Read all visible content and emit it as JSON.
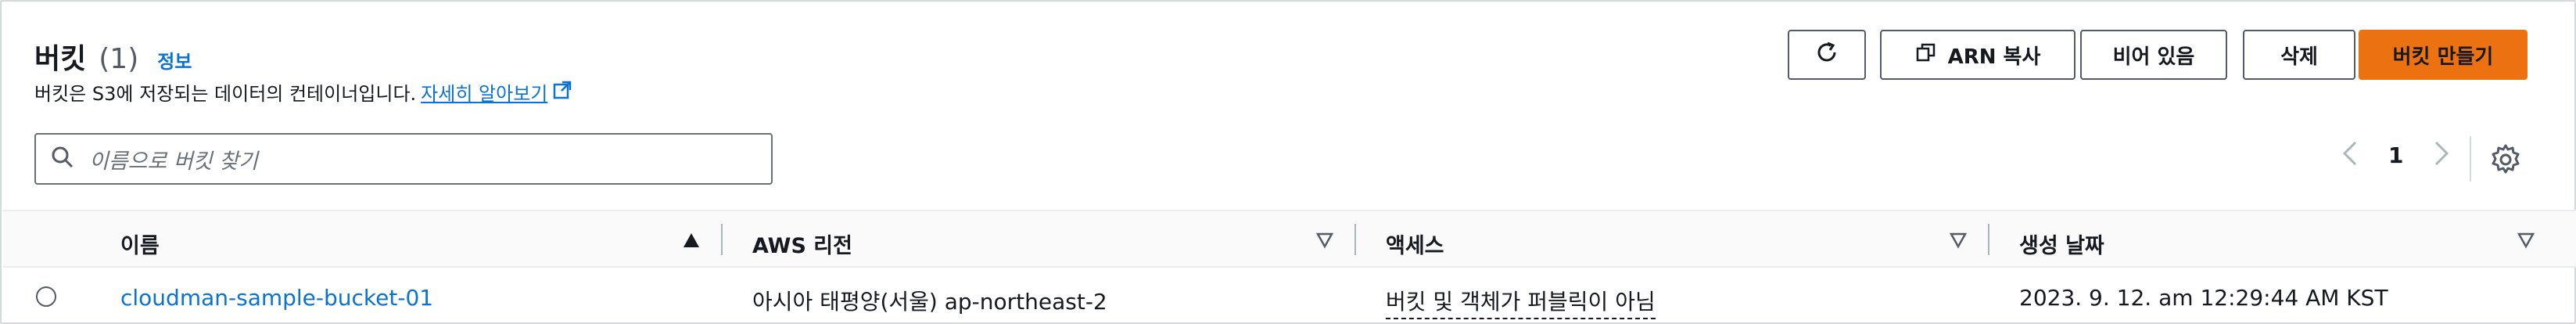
{
  "header": {
    "title": "버킷",
    "count": "(1)",
    "info": "정보",
    "description": "버킷은 S3에 저장되는 데이터의 컨테이너입니다.",
    "learn_more": "자세히 알아보기"
  },
  "toolbar": {
    "refresh_icon": "refresh-icon",
    "copy_arn": "ARN 복사",
    "empty": "비어 있음",
    "delete": "삭제",
    "create": "버킷 만들기"
  },
  "search": {
    "placeholder": "이름으로 버킷 찾기"
  },
  "pagination": {
    "current_page": "1"
  },
  "table": {
    "columns": [
      "이름",
      "AWS 리전",
      "액세스",
      "생성 날짜"
    ],
    "rows": [
      {
        "name": "cloudman-sample-bucket-01",
        "region": "아시아 태평양(서울) ap-northeast-2",
        "access": "버킷 및 객체가 퍼블릭이 아님",
        "created": "2023. 9. 12. am 12:29:44 AM KST"
      }
    ]
  },
  "colors": {
    "primary_button": "#ec7211",
    "link": "#0972d3",
    "border": "#545b64"
  }
}
